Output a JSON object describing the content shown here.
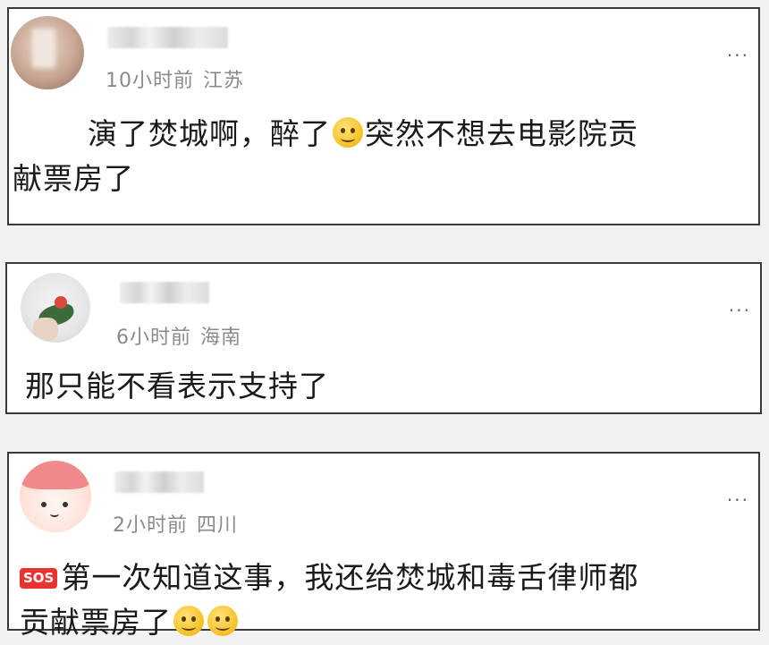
{
  "comments": [
    {
      "time": "10小时前",
      "location": "江苏",
      "more": "···",
      "text_line1_a": "演了焚城啊，醉了",
      "text_line1_b": "突然不想去电影院贡",
      "text_line2": "献票房了",
      "emoji": "woozy-face"
    },
    {
      "time": "6小时前",
      "location": "海南",
      "more": "···",
      "text": "那只能不看表示支持了"
    },
    {
      "time": "2小时前",
      "location": "四川",
      "more": "···",
      "sos_label": "SOS",
      "text_line1": "第一次知道这事，我还给焚城和毒舌律师都",
      "text_line2": "贡献票房了"
    }
  ]
}
